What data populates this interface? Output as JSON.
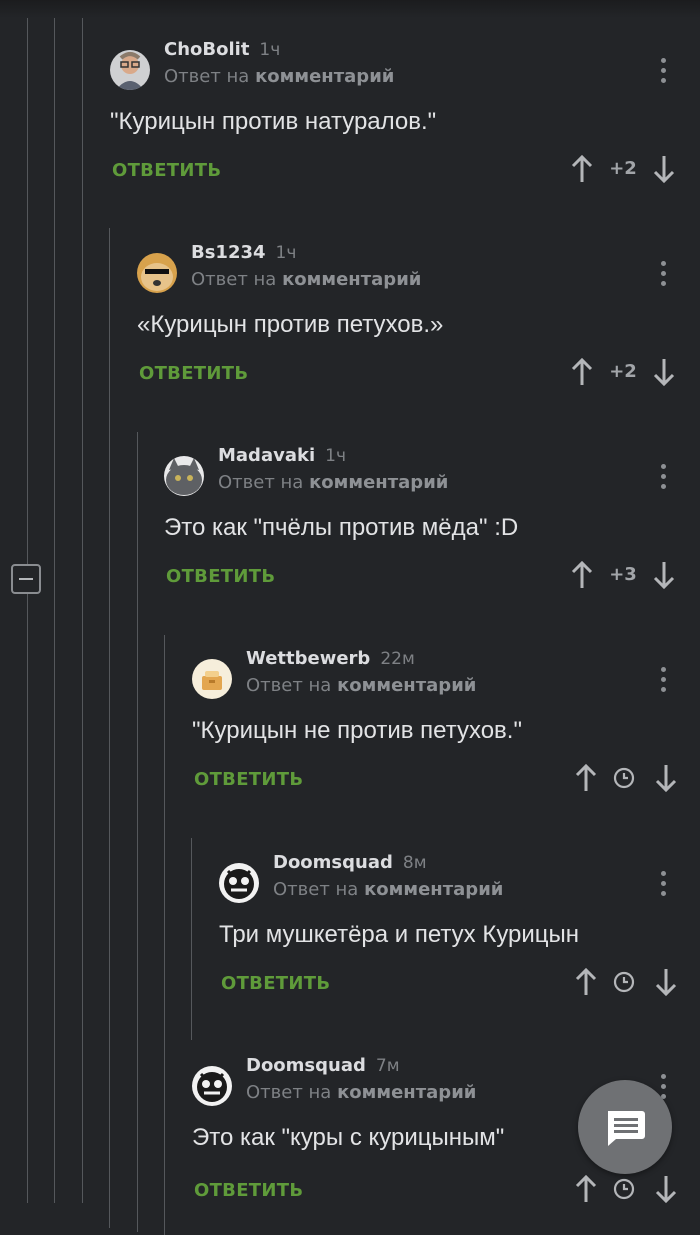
{
  "ui": {
    "reply_label": "ОТВЕТИТЬ",
    "reply_prefix": "Ответ на",
    "reply_target": "комментарий"
  },
  "comments": [
    {
      "author": "ChoBolit",
      "time": "1ч",
      "text": "\"Курицын против натуралов.\"",
      "score": "+2",
      "avatar_color": "#c9c9cb"
    },
    {
      "author": "Bs1234",
      "time": "1ч",
      "text": "«Курицын против петухов.»",
      "score": "+2",
      "avatar_color": "#d8a24c"
    },
    {
      "author": "Madavaki",
      "time": "1ч",
      "text": "Это как \"пчёлы против мёда\" :D",
      "score": "+3",
      "avatar_color": "#6a6c70"
    },
    {
      "author": "Wettbewerb",
      "time": "22м",
      "text": "\"Курицын не против петухов.\"",
      "score": "",
      "avatar_color": "#f1d9a6"
    },
    {
      "author": "Doomsquad",
      "time": "8м",
      "text": "Три мушкетёра и петух Курицын",
      "score": "",
      "avatar_color": "#f2f2f2"
    },
    {
      "author": "Doomsquad",
      "time": "7м",
      "text": "Это как \"куры с курицыным\"",
      "score": "",
      "avatar_color": "#f2f2f2"
    }
  ]
}
